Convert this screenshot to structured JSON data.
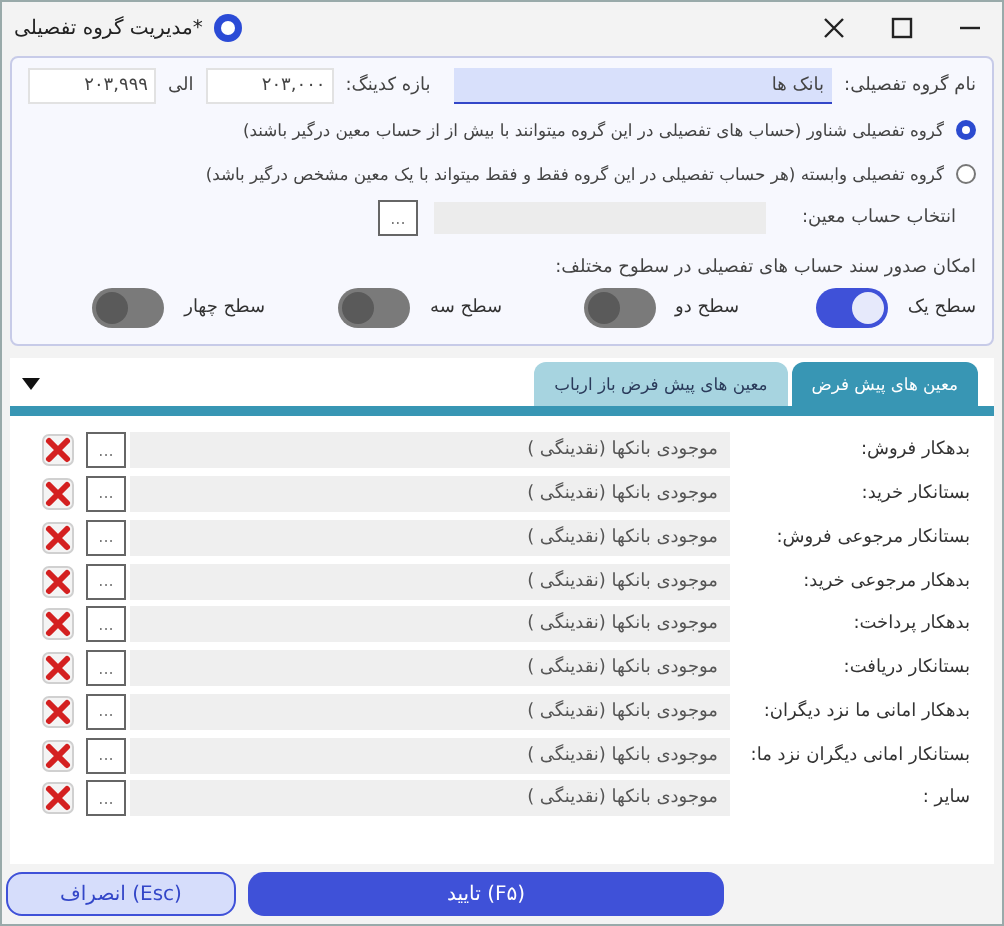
{
  "window": {
    "title": "مدیریت گروه تفصیلی*"
  },
  "group_name": {
    "label": "نام گروه تفصیلی:",
    "value": "بانک ها"
  },
  "coding_range": {
    "label": "بازه کدینگ:",
    "from": "۲۰۳,۰۰۰",
    "to_label": "الی",
    "to": "۲۰۳,۹۹۹"
  },
  "group_types": [
    {
      "label": "گروه تفصیلی شناور (حساب های تفصیلی در این گروه میتوانند با بیش از از حساب معین درگیر باشند)",
      "selected": true
    },
    {
      "label": "گروه تفصیلی وابسته (هر حساب تفصیلی در این گروه فقط و فقط میتواند با یک معین مشخص درگیر باشد)",
      "selected": false
    }
  ],
  "account_select": {
    "label": "انتخاب حساب معین:",
    "button": "..."
  },
  "levels": {
    "label": "امکان صدور سند حساب های تفصیلی در سطوح مختلف:",
    "toggles": [
      {
        "label": "سطح یک",
        "on": true
      },
      {
        "label": "سطح دو",
        "on": false
      },
      {
        "label": "سطح سه",
        "on": false
      },
      {
        "label": "سطح چهار",
        "on": false
      }
    ]
  },
  "tabs": [
    {
      "label": "معین های پیش فرض",
      "selected": true
    },
    {
      "label": "معین های پیش فرض باز ارباب",
      "selected": false
    }
  ],
  "default_accounts": [
    {
      "label": "بدهکار فروش:",
      "value": "موجودی بانکها (نقدینگی )",
      "button": "..."
    },
    {
      "label": "بستانکار خرید:",
      "value": "موجودی بانکها (نقدینگی )",
      "button": "..."
    },
    {
      "label": "بستانکار مرجوعی فروش:",
      "value": "موجودی بانکها (نقدینگی )",
      "button": "..."
    },
    {
      "label": "بدهکار مرجوعی خرید:",
      "value": "موجودی بانکها (نقدینگی )",
      "button": "..."
    },
    {
      "label": "بدهکار پرداخت:",
      "value": "موجودی بانکها (نقدینگی )",
      "button": "..."
    },
    {
      "label": "بستانکار دریافت:",
      "value": "موجودی بانکها (نقدینگی )",
      "button": "..."
    },
    {
      "label": "بدهکار امانی ما نزد دیگران:",
      "value": "موجودی بانکها (نقدینگی )",
      "button": "..."
    },
    {
      "label": "بستانکار امانی دیگران نزد ما:",
      "value": "موجودی بانکها (نقدینگی )",
      "button": "..."
    },
    {
      "label": "سایر :",
      "value": "موجودی بانکها (نقدینگی )",
      "button": "..."
    }
  ],
  "buttons": [
    {
      "label": "تایید (F۵)",
      "kind": "primary"
    },
    {
      "label": "انصراف (Esc)",
      "kind": "secondary"
    }
  ]
}
